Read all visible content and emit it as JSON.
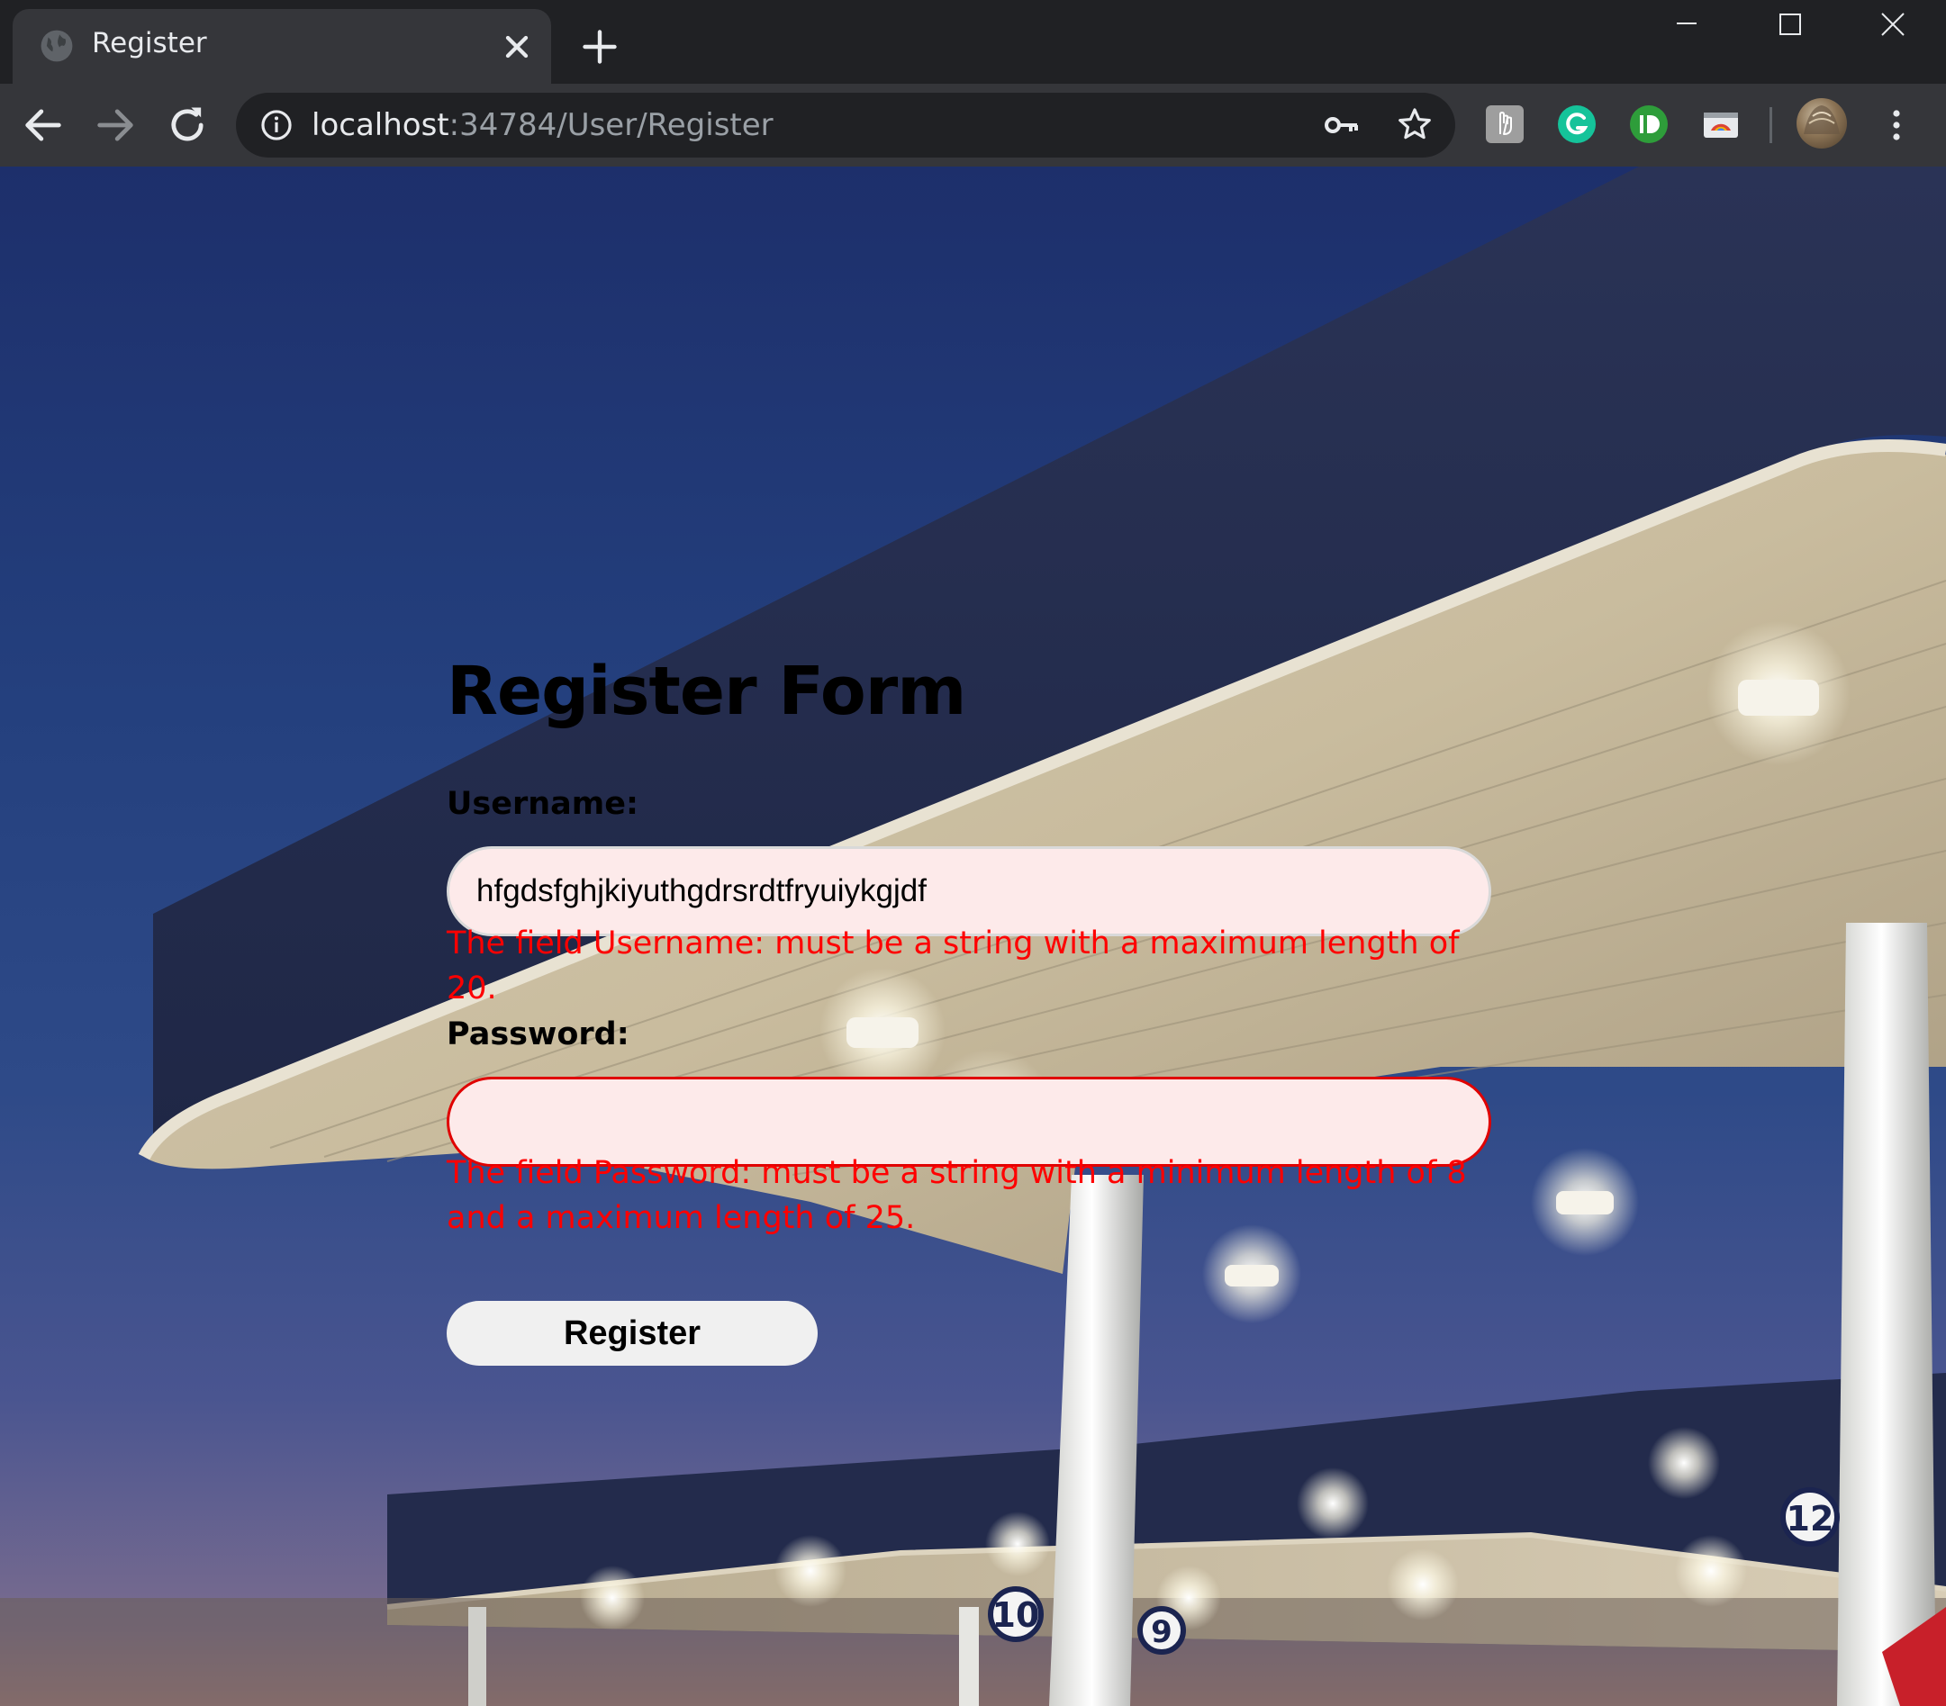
{
  "browser": {
    "tab_title": "Register",
    "url_host": "localhost",
    "url_path": ":34784/User/Register"
  },
  "icons": {
    "tab_favicon": "globe-icon",
    "tab_close": "close-icon",
    "new_tab": "plus-icon",
    "back": "arrow-left-icon",
    "forward": "arrow-right-icon",
    "reload": "reload-icon",
    "site_info": "info-icon",
    "passwords": "key-icon",
    "bookmark": "star-icon",
    "menu": "kebab-menu-icon"
  },
  "extensions": [
    "hand-extension-icon",
    "grammarly-icon",
    "id-extension-icon",
    "cast-extension-icon"
  ],
  "form": {
    "title": "Register Form",
    "username_label": "Username:",
    "username_value": "hfgdsfghjkiyuthgdrsrdtfryuiykgjdf",
    "username_error": "The field Username: must be a string with a maximum length of 20.",
    "password_label": "Password:",
    "password_value": "",
    "password_error": "The field Password: must be a string with a minimum length of 8 and a maximum length of 25.",
    "submit_label": "Register"
  },
  "colors": {
    "error": "#ff0000",
    "field_bg": "#fdeaea",
    "chrome_dark": "#202124",
    "chrome_toolbar": "#35363a"
  }
}
